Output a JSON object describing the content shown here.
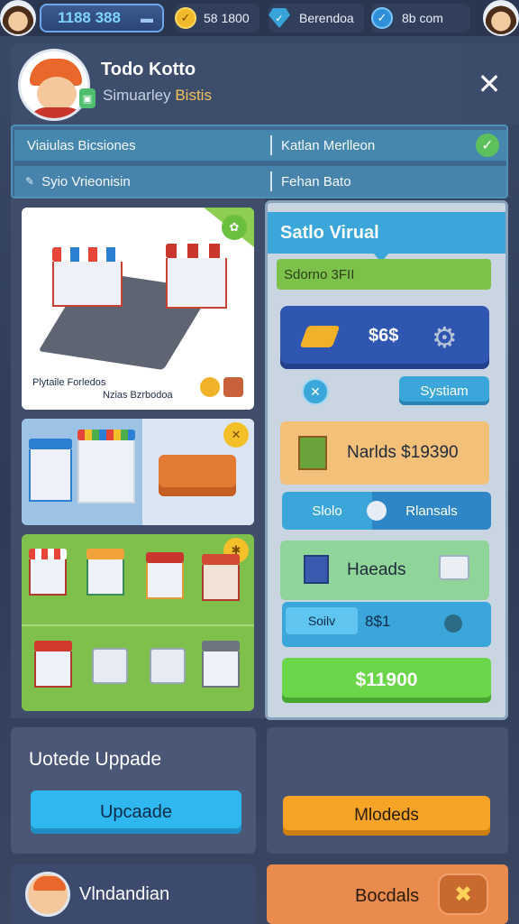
{
  "topbar": {
    "cash": "1188 388",
    "coins": "58 1800",
    "gems": "Berendoa",
    "checks": "8b com",
    "icons": {
      "cash": "cash-icon",
      "coin": "coin-icon",
      "gem": "gem-icon",
      "check": "check-icon"
    }
  },
  "profile": {
    "name": "Todo Kotto",
    "subtitle_a": "Simuarley",
    "subtitle_b": "Bistis"
  },
  "info": {
    "row1_left": "Viaiulas Bicsiones",
    "row1_right": "Katlan Merlleon",
    "row2_left": "Syio Vrieonisin",
    "row2_right": "Fehan Bato"
  },
  "left_cards": {
    "card1_caption1": "Plytaile Forledos",
    "card1_caption2": "Nzias Bzrbodoa"
  },
  "right_panel": {
    "title": "Satlo Virual",
    "green_bar": "Sdorno 3FII",
    "blue_value": "$6$",
    "system_button": "Systiam",
    "orange_text": "Narlds $19390",
    "tab_a": "Slolo",
    "tab_b": "Rlansals",
    "green_card_text": "Haeads",
    "field_label": "Soilv",
    "field_value": "8$1",
    "buy_label": "$11900"
  },
  "bottom": {
    "left_title": "Uotede Uppade",
    "upgrade_button": "Upcaade",
    "models_button": "Mlodeds",
    "footer_left": "Vlndandian",
    "footer_right": "Bocdals"
  },
  "colors": {
    "background": "#3a4a66",
    "accent_blue": "#3aa6da",
    "accent_green": "#6bd64a",
    "accent_orange": "#f7a325"
  }
}
